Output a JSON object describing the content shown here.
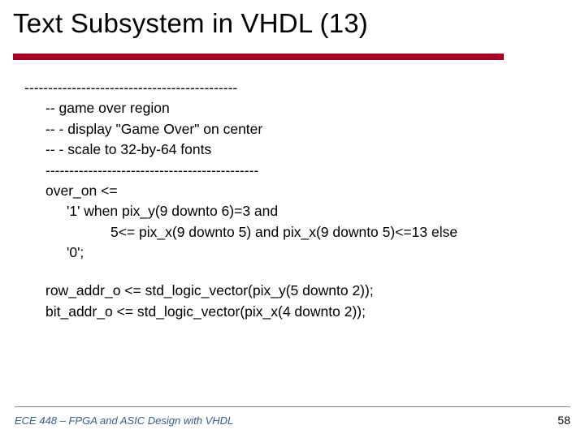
{
  "title": "Text Subsystem in VHDL (13)",
  "body": {
    "dash_top": "---------------------------------------------",
    "c1": "-- game over region",
    "c2": "--  - display \"Game Over\" on center",
    "c3": "--  - scale to 32-by-64 fonts",
    "dash_mid": "---------------------------------------------",
    "l1": "over_on <=",
    "l2": "'1' when pix_y(9 downto 6)=3 and",
    "l3": "5<= pix_x(9 downto 5) and pix_x(9 downto 5)<=13 else",
    "l4": "'0';",
    "l5": "row_addr_o <= std_logic_vector(pix_y(5 downto 2));",
    "l6": "bit_addr_o <= std_logic_vector(pix_x(4 downto 2));"
  },
  "footer": {
    "left": "ECE 448 – FPGA and ASIC Design with VHDL",
    "page": "58"
  }
}
